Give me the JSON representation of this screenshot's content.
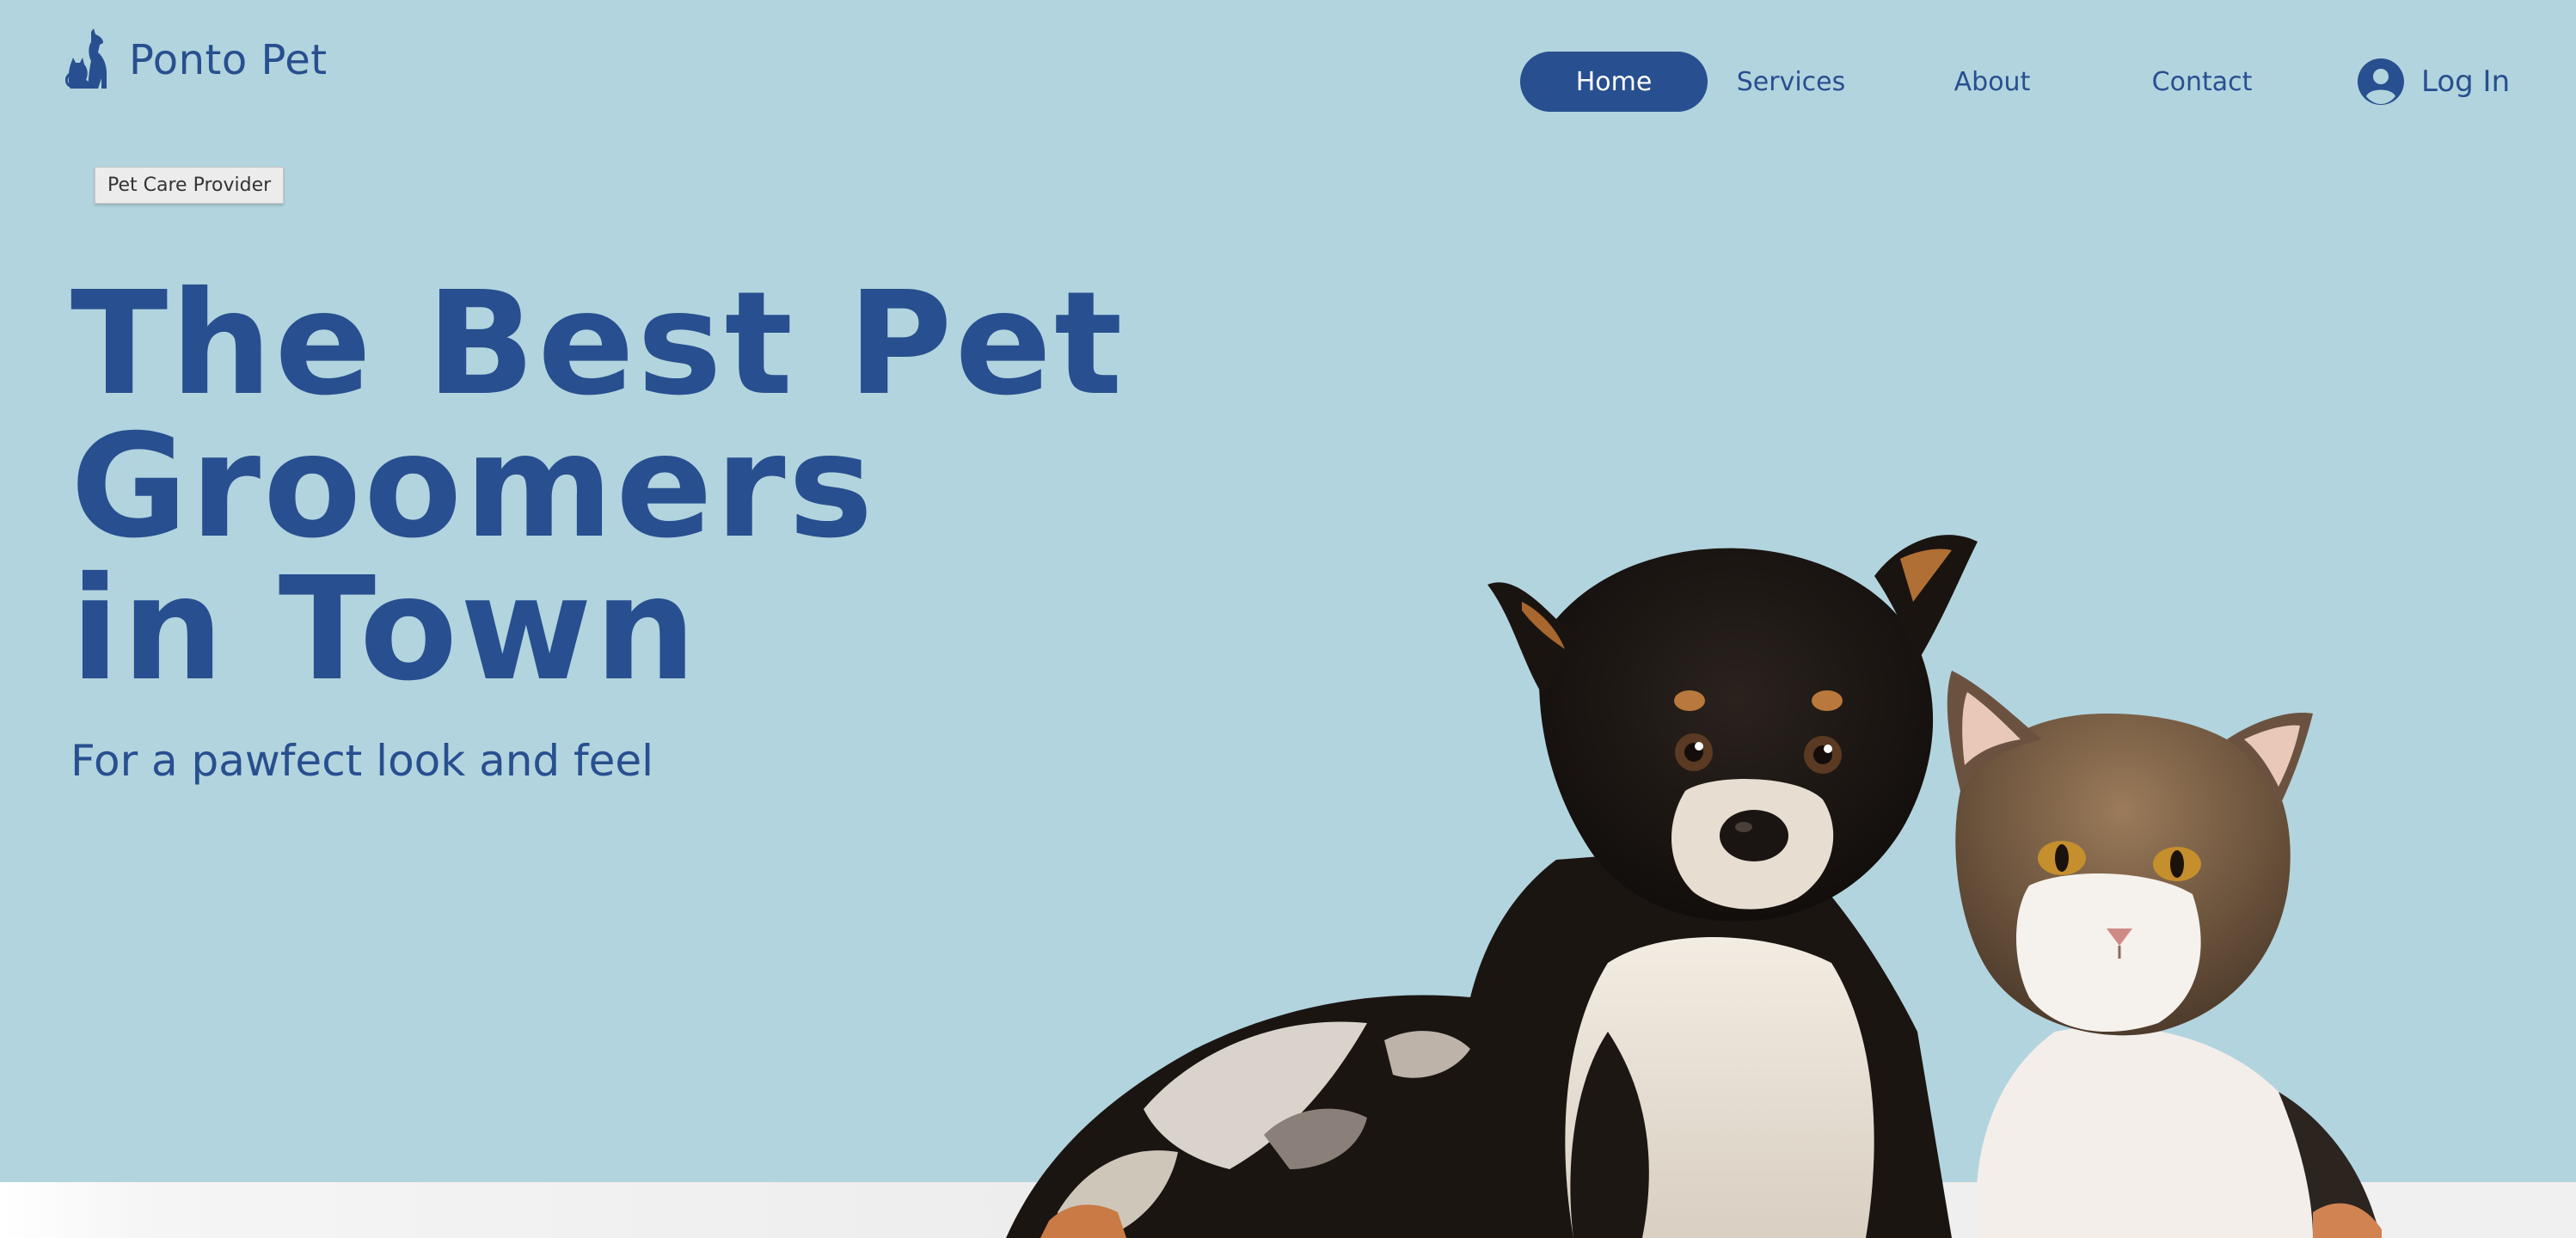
{
  "header": {
    "logo_text": "Ponto Pet",
    "logo_icon": "dog-and-cat-icon"
  },
  "nav": {
    "items": [
      {
        "label": "Home",
        "active": true
      },
      {
        "label": "Services",
        "active": false
      },
      {
        "label": "About",
        "active": false
      },
      {
        "label": "Contact",
        "active": false
      }
    ],
    "login_label": "Log In",
    "login_icon": "user-avatar-icon"
  },
  "badge": {
    "label": "Pet Care Provider"
  },
  "hero": {
    "title_lines": [
      "The Best Pet",
      "Groomers",
      "in Town"
    ],
    "subtitle": "For a pawfect look and feel"
  },
  "colors": {
    "background": "#b2d4de",
    "brand_blue": "#284f8f",
    "active_nav_text": "#ffffff",
    "bottom_strip": "#efefef"
  }
}
